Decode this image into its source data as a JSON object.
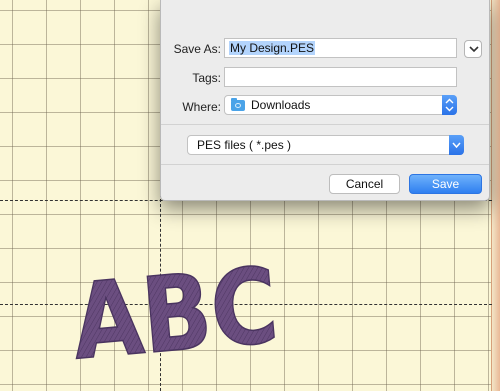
{
  "dialog": {
    "save_as_label": "Save As:",
    "save_as_value": "My Design.PES",
    "tags_label": "Tags:",
    "tags_value": "",
    "where_label": "Where:",
    "where_value": "Downloads",
    "file_format": "PES files ( *.pes )",
    "cancel_label": "Cancel",
    "save_label": "Save"
  },
  "canvas": {
    "design_text": "ABC",
    "thread_color": "#6b4e80",
    "background_color": "#fbf7d7"
  },
  "icons": {
    "expand": "chevron-down-icon",
    "location": "folder-icon",
    "popup_arrows": "up-down-arrows-icon"
  }
}
